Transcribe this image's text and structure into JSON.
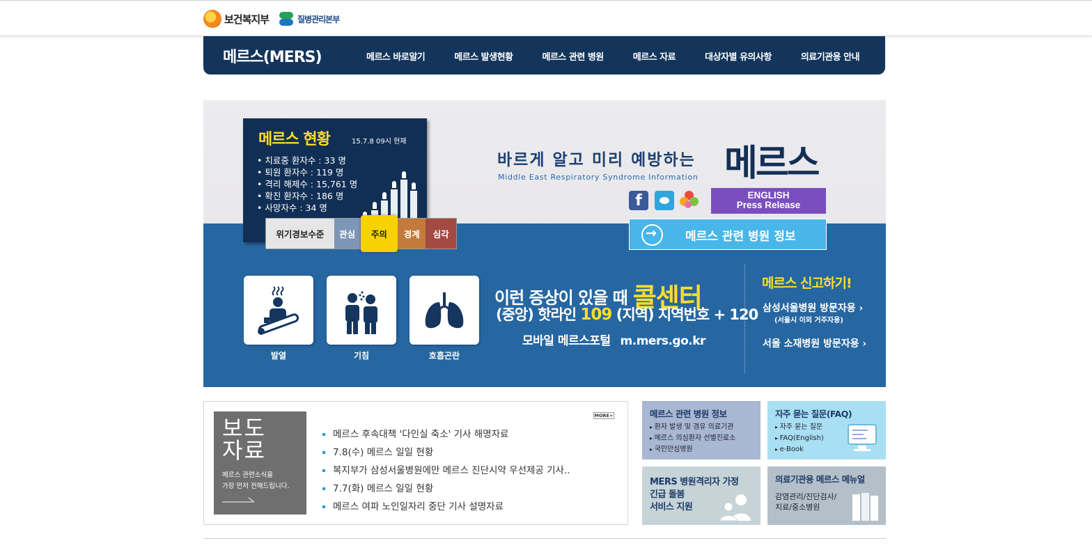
{
  "header": {
    "logo_mohw": "보건복지부",
    "logo_kcdc": "질병관리본부"
  },
  "nav": {
    "brand": "메르스(MERS)",
    "items": [
      {
        "label": "메르스 바로알기"
      },
      {
        "label": "메르스 발생현황"
      },
      {
        "label": "메르스 관련 병원"
      },
      {
        "label": "메르스 자료"
      },
      {
        "label": "대상자별 유의사항"
      },
      {
        "label": "의료기관용 안내"
      }
    ]
  },
  "status": {
    "title": "메르스 현황",
    "date": "15.7.8 09시 현재",
    "items": [
      "치료중 환자수 : 33 명",
      "퇴원 환자수 : 119 명",
      "격리 해제수 : 15,761 명",
      "확진 환자수 : 186 명",
      "사망자수 : 34 명"
    ]
  },
  "alert_level": {
    "label": "위기경보수준",
    "levels": [
      "관심",
      "주의",
      "경계",
      "심각"
    ],
    "current": "주의"
  },
  "banner": {
    "slogan": "바르게 알고 미리 예방하는",
    "slogan_en": "Middle East Respiratory Syndrome Information",
    "mers_title": "메르스",
    "english_line1": "ENGLISH",
    "english_line2": "Press Release",
    "hospital_info_button": "메르스 관련 병원 정보",
    "facebook_letter": "f"
  },
  "symptoms": [
    {
      "label": "발열",
      "icon": "fever-icon"
    },
    {
      "label": "기침",
      "icon": "cough-icon"
    },
    {
      "label": "호흡곤란",
      "icon": "lungs-icon"
    }
  ],
  "callcenter": {
    "line1": "이런 증상이 있을 때",
    "line1_highlight": "콜센터",
    "line2_a": "(중앙) 핫라인",
    "line2_num": "109",
    "line2_b": "(지역) 지역번호 + 120",
    "line3_a": "모바일 메르스포털",
    "line3_b": "m.mers.go.kr"
  },
  "report": {
    "title": "메르스 신고하기!",
    "link1": "삼성서울병원 방문자용 ›",
    "link1_sub": "(서울시 이외 거주자용)",
    "link2": "서울 소재병원 방문자용 ›"
  },
  "press": {
    "title_line1": "보도",
    "title_line2": "자료",
    "sub_line1": "메르스 관련소식을",
    "sub_line2": "가장 먼저 전해드립니다.",
    "more": "MORE+",
    "items": [
      "메르스 후속대책 '다인실 축소' 기사 해명자료",
      "7.8(수) 메르스 일일 현황",
      "복지부가 삼성서울병원에만 메르스 진단시약 우선제공 기사..",
      "7.7(화) 메르스 일일 현황",
      "메르스 여파 노인일자리 중단 기사 설명자료"
    ]
  },
  "side_boxes": {
    "hospital": {
      "title": "메르스 관련 병원 정보",
      "items": [
        "환자 발생 및 경유 의료기관",
        "메르스 의심환자 선별진료소",
        "국민안심병원"
      ]
    },
    "faq": {
      "title": "자주 묻는 질문(FAQ)",
      "items": [
        "자주 묻는 질문",
        "FAQ(English)",
        "e-Book"
      ]
    },
    "care": {
      "line1": "MERS 병원격리자 가정",
      "line2": "긴급 돌봄",
      "line3": "서비스 지원"
    },
    "manual": {
      "title": "의료기관용 메르스 메뉴얼",
      "line1": "감염관리/진단검사/",
      "line2": "치료/중소병원"
    }
  }
}
